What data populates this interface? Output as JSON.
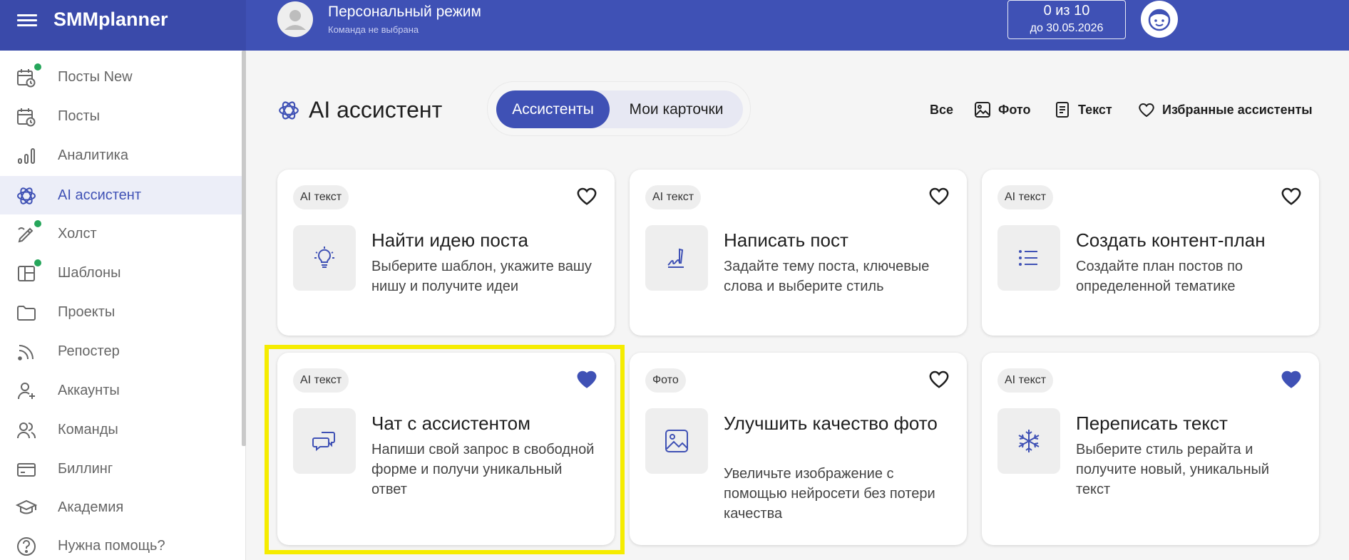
{
  "app": {
    "brand": "SMMplanner"
  },
  "header": {
    "team_title": "Персональный режим",
    "team_subtitle": "Команда не выбрана",
    "quota_count": "0 из 10",
    "quota_until": "до 30.05.2026"
  },
  "sidebar": {
    "items": [
      {
        "label": "Посты New",
        "icon": "calendar-clock-icon",
        "dot": true
      },
      {
        "label": "Посты",
        "icon": "calendar-clock-icon",
        "dot": false
      },
      {
        "label": "Аналитика",
        "icon": "bar-chart-icon",
        "dot": false
      },
      {
        "label": "AI ассистент",
        "icon": "ai-knot-icon",
        "dot": false,
        "active": true
      },
      {
        "label": "Холст",
        "icon": "pen-canvas-icon",
        "dot": true
      },
      {
        "label": "Шаблоны",
        "icon": "template-icon",
        "dot": true
      },
      {
        "label": "Проекты",
        "icon": "folder-icon",
        "dot": false
      },
      {
        "label": "Репостер",
        "icon": "rss-icon",
        "dot": false
      },
      {
        "label": "Аккаунты",
        "icon": "user-add-icon",
        "dot": false
      },
      {
        "label": "Команды",
        "icon": "users-icon",
        "dot": false
      },
      {
        "label": "Биллинг",
        "icon": "credit-card-icon",
        "dot": false
      },
      {
        "label": "Академия",
        "icon": "graduation-cap-icon",
        "dot": false
      },
      {
        "label": "Нужна помощь?",
        "icon": "help-circle-icon",
        "dot": false
      }
    ]
  },
  "main": {
    "title": "AI ассистент",
    "tabs": [
      {
        "label": "Ассистенты",
        "active": true
      },
      {
        "label": "Мои карточки",
        "active": false
      }
    ],
    "filters": {
      "all": "Все",
      "photo": "Фото",
      "text": "Текст",
      "favorites": "Избранные ассистенты"
    },
    "cards": [
      {
        "tag": "AI текст",
        "title": "Найти идею поста",
        "description": "Выберите шаблон, укажите вашу нишу и получите идеи",
        "icon": "lightbulb-icon",
        "favorite": false
      },
      {
        "tag": "AI текст",
        "title": "Написать пост",
        "description": "Задайте тему поста, ключевые слова и выберите стиль",
        "icon": "pen-scribble-icon",
        "favorite": false
      },
      {
        "tag": "AI текст",
        "title": "Создать контент-план",
        "description": "Создайте план постов по определенной тематике",
        "icon": "list-icon",
        "favorite": false
      },
      {
        "tag": "AI текст",
        "title": "Чат с ассистентом",
        "description": "Напиши свой запрос в свободной форме и получи уникальный ответ",
        "icon": "chat-bubbles-icon",
        "favorite": true
      },
      {
        "tag": "Фото",
        "title": "Улучшить качество фото",
        "description": "Увеличьте изображение с помощью нейросети без потери качества",
        "icon": "image-icon",
        "favorite": false
      },
      {
        "tag": "AI текст",
        "title": "Переписать текст",
        "description": "Выберите стиль рерайта и получите новый, уникальный текст",
        "icon": "snowflake-icon",
        "favorite": true
      }
    ]
  },
  "colors": {
    "primary": "#3f51b5",
    "online_dot": "#26a65b",
    "highlight": "#f5ec00"
  }
}
